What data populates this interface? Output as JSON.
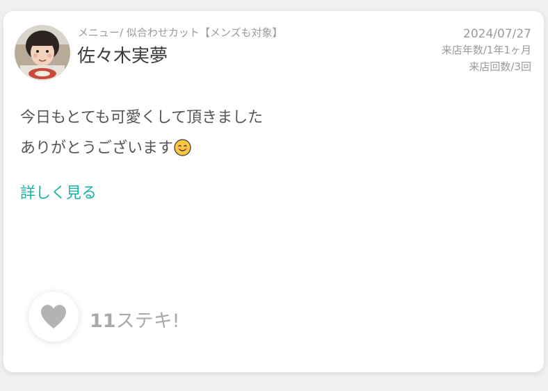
{
  "review": {
    "menu": "メニュー/ 似合わせカット【メンズも対象】",
    "author": "佐々木実夢",
    "date": "2024/07/27",
    "visit_years": "来店年数/1年1ヶ月",
    "visit_count": "来店回数/3回",
    "body_line1": "今日もとても可愛くして頂きました",
    "body_line2": "ありがとうございます",
    "emoji": "smiling-face-emoji",
    "read_more": "詳しく見る"
  },
  "like": {
    "count": "11",
    "label": "ステキ!",
    "icon": "heart-icon"
  },
  "colors": {
    "accent": "#1cb3a6",
    "muted_text": "#9a9a9a",
    "body_text": "#555555",
    "heart": "#b3b3b3"
  }
}
